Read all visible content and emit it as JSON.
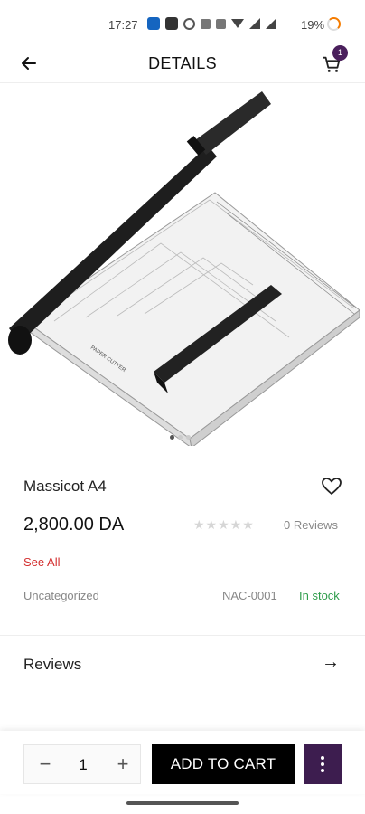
{
  "status_bar": {
    "time": "17:27",
    "battery": "19%"
  },
  "header": {
    "back_icon": "back-arrow-icon",
    "title": "DETAILS",
    "cart_icon": "cart-icon",
    "cart_count": "1"
  },
  "image": {
    "label_on_product": "PAPER CUTTER"
  },
  "product": {
    "name": "Massicot A4",
    "price": "2,800.00 DA",
    "rating_stars": "★★★★★",
    "rating_value": 0,
    "reviews_count": "0 Reviews",
    "see_all": "See All",
    "category": "Uncategorized",
    "sku": "NAC-0001",
    "stock": "In stock"
  },
  "sections": {
    "reviews_label": "Reviews",
    "reviews_arrow": "→"
  },
  "bottom_bar": {
    "qty_minus": "−",
    "qty_value": "1",
    "qty_plus": "+",
    "add_to_cart": "ADD TO CART"
  },
  "colors": {
    "accent": "#3d1d4f",
    "stock_green": "#2e9d4b",
    "see_all_red": "#d32f2f"
  }
}
